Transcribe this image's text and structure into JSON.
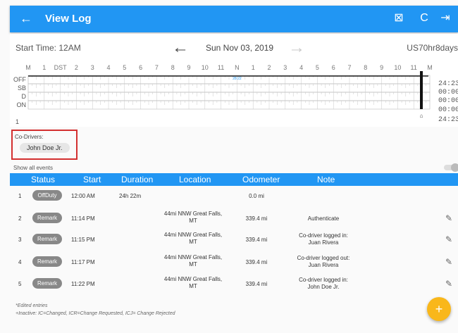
{
  "topbar": {
    "back_icon": "←",
    "title": "View Log",
    "icons": [
      "export-icon",
      "refresh-icon",
      "logout-icon"
    ],
    "icon_glyphs": [
      "⊠",
      "C",
      "⇥"
    ]
  },
  "date_row": {
    "start_time": "Start Time: 12AM",
    "date": "Sun Nov 03, 2019",
    "ruleset": "US70hr8days",
    "arrow_left": "←",
    "arrow_right": "→"
  },
  "graph": {
    "hour_labels": [
      "M",
      "1",
      "DST",
      "2",
      "3",
      "4",
      "5",
      "6",
      "7",
      "8",
      "9",
      "10",
      "11",
      "N",
      "1",
      "2",
      "3",
      "4",
      "5",
      "6",
      "7",
      "8",
      "9",
      "10",
      "11",
      "M"
    ],
    "status_labels": [
      "OFF",
      "SB",
      "D",
      "ON"
    ],
    "totals": [
      "24:23",
      "00:00",
      "00:00",
      "00:00",
      "24:23"
    ],
    "bottom_left": "1",
    "marker_text": "28:22"
  },
  "co_drivers": {
    "label": "Co-Drivers:",
    "name": "John Doe Jr."
  },
  "show_all_events": "Show all events",
  "table": {
    "headers": [
      "Status",
      "Start",
      "Duration",
      "Location",
      "Odometer",
      "Note"
    ],
    "rows": [
      {
        "num": "1",
        "status": "OffDuty",
        "start": "12:00 AM",
        "duration": "24h 22m",
        "location_l1": "",
        "location_l2": "",
        "odometer": "0.0 mi",
        "note_l1": "",
        "note_l2": "",
        "editable": false
      },
      {
        "num": "2",
        "status": "Remark",
        "start": "11:14 PM",
        "duration": "",
        "location_l1": "44mi NNW Great Falls,",
        "location_l2": "MT",
        "odometer": "339.4 mi",
        "note_l1": "Authenticate",
        "note_l2": "",
        "editable": true
      },
      {
        "num": "3",
        "status": "Remark",
        "start": "11:15 PM",
        "duration": "",
        "location_l1": "44mi NNW Great Falls,",
        "location_l2": "MT",
        "odometer": "339.4 mi",
        "note_l1": "Co-driver logged in:",
        "note_l2": "Juan Rivera",
        "editable": true
      },
      {
        "num": "4",
        "status": "Remark",
        "start": "11:17 PM",
        "duration": "",
        "location_l1": "44mi NNW Great Falls,",
        "location_l2": "MT",
        "odometer": "339.4 mi",
        "note_l1": "Co-driver logged out:",
        "note_l2": "Juan Rivera",
        "editable": true
      },
      {
        "num": "5",
        "status": "Remark",
        "start": "11:22 PM",
        "duration": "",
        "location_l1": "44mi NNW Great Falls,",
        "location_l2": "MT",
        "odometer": "339.4 mi",
        "note_l1": "Co-driver logged in:",
        "note_l2": "John Doe Jr.",
        "editable": true
      }
    ]
  },
  "footer": {
    "line1": "*Edited entries",
    "line2": "+Inactive: IC=Changed, ICR=Change Requested, ICJ= Change Rejected"
  },
  "fab_label": "+",
  "edit_glyph": "✎"
}
